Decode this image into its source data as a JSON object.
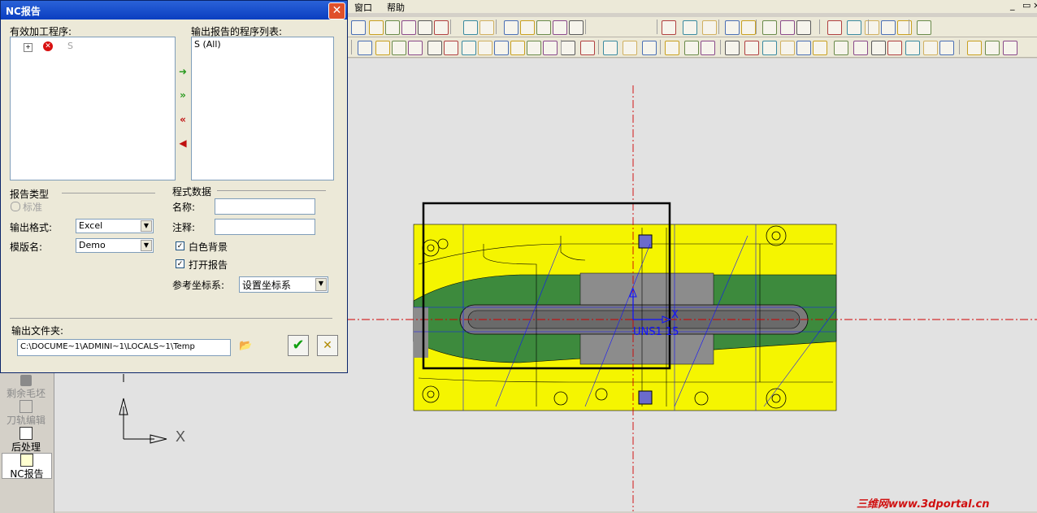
{
  "menubar": {
    "window": "窗口",
    "help": "帮助"
  },
  "dialog": {
    "title": "NC报告",
    "valid_programs_label": "有效加工程序:",
    "tree_item_text": "S",
    "output_list_label": "输出报告的程序列表:",
    "output_list_item": "S (All)",
    "report_type_label": "报告类型",
    "report_type_option": "标准",
    "output_format_label": "输出格式:",
    "output_format_value": "Excel",
    "template_label": "模版名:",
    "template_value": "Demo",
    "program_data_label": "程式数据",
    "name_label": "名称:",
    "note_label": "注释:",
    "white_bg_label": "白色背景",
    "open_report_label": "打开报告",
    "ref_coord_label": "参考坐标系:",
    "ref_coord_value": "设置坐标系",
    "output_folder_label": "输出文件夹:",
    "output_folder_value": "C:\\DOCUME~1\\ADMINI~1\\LOCALS~1\\Temp"
  },
  "left_panel": {
    "items": [
      {
        "label": "剩余毛坯"
      },
      {
        "label": "刀轨编辑"
      },
      {
        "label": "后处理"
      },
      {
        "label": "NC报告"
      }
    ]
  },
  "viewport": {
    "axis_x_label": "X",
    "model_x_label": "X",
    "coord_name": "UNS1 15"
  },
  "watermark": "三维网www.3dportal.cn",
  "colors": {
    "yellow": "#f5f500",
    "green": "#3d8a3d",
    "gray": "#8c8c8c",
    "axis_red": "#d00000"
  }
}
